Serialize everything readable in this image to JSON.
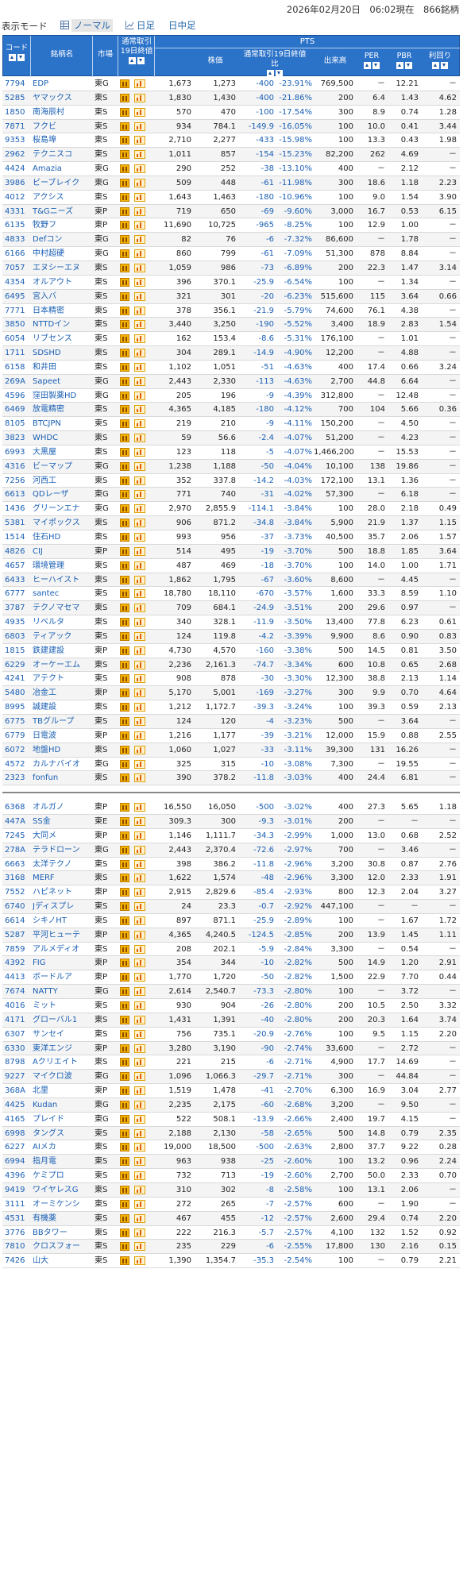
{
  "header": {
    "timestamp": "2026年02月20日　06:02現在　866銘柄"
  },
  "modes": {
    "label": "表示モード",
    "items": [
      {
        "label": "ノーマル",
        "icon": "grid-icon",
        "active": true
      },
      {
        "label": "日足",
        "icon": "line-chart-icon",
        "active": false
      },
      {
        "label": "日中足",
        "icon": "none",
        "active": false
      }
    ]
  },
  "columns": {
    "code": "コード",
    "name": "銘柄名",
    "market": "市場",
    "close": "通常取引19日終値",
    "pts": "PTS",
    "price": "株価",
    "chg": "通常取引19日終値比",
    "vol": "出来高",
    "per": "PER",
    "pbr": "PBR",
    "yield": "利回り"
  },
  "colors": {
    "header_bg": "#2b72c9",
    "link": "#1a5fb4",
    "negative": "#1a5fb4"
  },
  "rows": [
    [
      "7794",
      "EDP",
      "東G",
      "1,673",
      "1,273",
      "-400",
      "-23.91%",
      "769,500",
      "－",
      "12.21",
      "－"
    ],
    [
      "5285",
      "ヤマックス",
      "東S",
      "1,830",
      "1,430",
      "-400",
      "-21.86%",
      "200",
      "6.4",
      "1.43",
      "4.62"
    ],
    [
      "1850",
      "南海辰村",
      "東S",
      "570",
      "470",
      "-100",
      "-17.54%",
      "300",
      "8.9",
      "0.74",
      "1.28"
    ],
    [
      "7871",
      "フクビ",
      "東S",
      "934",
      "784.1",
      "-149.9",
      "-16.05%",
      "100",
      "10.0",
      "0.41",
      "3.44"
    ],
    [
      "9353",
      "桜島埠",
      "東S",
      "2,710",
      "2,277",
      "-433",
      "-15.98%",
      "100",
      "13.3",
      "0.43",
      "1.98"
    ],
    [
      "2962",
      "テクニスコ",
      "東S",
      "1,011",
      "857",
      "-154",
      "-15.23%",
      "82,200",
      "262",
      "4.69",
      "－"
    ],
    [
      "4424",
      "Amazia",
      "東G",
      "290",
      "252",
      "-38",
      "-13.10%",
      "400",
      "－",
      "2.12",
      "－"
    ],
    [
      "3986",
      "ビーブレイク",
      "東G",
      "509",
      "448",
      "-61",
      "-11.98%",
      "300",
      "18.6",
      "1.18",
      "2.23"
    ],
    [
      "4012",
      "アクシス",
      "東S",
      "1,643",
      "1,463",
      "-180",
      "-10.96%",
      "100",
      "9.0",
      "1.54",
      "3.90"
    ],
    [
      "4331",
      "T&Gニーズ",
      "東P",
      "719",
      "650",
      "-69",
      "-9.60%",
      "3,000",
      "16.7",
      "0.53",
      "6.15"
    ],
    [
      "6135",
      "牧野フ",
      "東P",
      "11,690",
      "10,725",
      "-965",
      "-8.25%",
      "100",
      "12.9",
      "1.00",
      "－"
    ],
    [
      "4833",
      "Defコン",
      "東G",
      "82",
      "76",
      "-6",
      "-7.32%",
      "86,600",
      "－",
      "1.78",
      "－"
    ],
    [
      "6166",
      "中村超硬",
      "東G",
      "860",
      "799",
      "-61",
      "-7.09%",
      "51,300",
      "878",
      "8.84",
      "－"
    ],
    [
      "7057",
      "エヌシーエヌ",
      "東S",
      "1,059",
      "986",
      "-73",
      "-6.89%",
      "200",
      "22.3",
      "1.47",
      "3.14"
    ],
    [
      "4354",
      "オルアウト",
      "東S",
      "396",
      "370.1",
      "-25.9",
      "-6.54%",
      "100",
      "－",
      "1.34",
      "－"
    ],
    [
      "6495",
      "宮入バ",
      "東S",
      "321",
      "301",
      "-20",
      "-6.23%",
      "515,600",
      "115",
      "3.64",
      "0.66"
    ],
    [
      "7771",
      "日本精密",
      "東S",
      "378",
      "356.1",
      "-21.9",
      "-5.79%",
      "74,600",
      "76.1",
      "4.38",
      "－"
    ],
    [
      "3850",
      "NTTDイン",
      "東S",
      "3,440",
      "3,250",
      "-190",
      "-5.52%",
      "3,400",
      "18.9",
      "2.83",
      "1.54"
    ],
    [
      "6054",
      "リブセンス",
      "東S",
      "162",
      "153.4",
      "-8.6",
      "-5.31%",
      "176,100",
      "－",
      "1.01",
      "－"
    ],
    [
      "1711",
      "SDSHD",
      "東S",
      "304",
      "289.1",
      "-14.9",
      "-4.90%",
      "12,200",
      "－",
      "4.88",
      "－"
    ],
    [
      "6158",
      "和井田",
      "東S",
      "1,102",
      "1,051",
      "-51",
      "-4.63%",
      "400",
      "17.4",
      "0.66",
      "3.24"
    ],
    [
      "269A",
      "Sapeet",
      "東G",
      "2,443",
      "2,330",
      "-113",
      "-4.63%",
      "2,700",
      "44.8",
      "6.64",
      "－"
    ],
    [
      "4596",
      "窪田製薬HD",
      "東G",
      "205",
      "196",
      "-9",
      "-4.39%",
      "312,800",
      "－",
      "12.48",
      "－"
    ],
    [
      "6469",
      "放電精密",
      "東S",
      "4,365",
      "4,185",
      "-180",
      "-4.12%",
      "700",
      "104",
      "5.66",
      "0.36"
    ],
    [
      "8105",
      "BTCJPN",
      "東S",
      "219",
      "210",
      "-9",
      "-4.11%",
      "150,200",
      "－",
      "4.50",
      "－"
    ],
    [
      "3823",
      "WHDC",
      "東S",
      "59",
      "56.6",
      "-2.4",
      "-4.07%",
      "51,200",
      "－",
      "4.23",
      "－"
    ],
    [
      "6993",
      "大黒屋",
      "東S",
      "123",
      "118",
      "-5",
      "-4.07%",
      "1,466,200",
      "－",
      "15.53",
      "－"
    ],
    [
      "4316",
      "ビーマップ",
      "東G",
      "1,238",
      "1,188",
      "-50",
      "-4.04%",
      "10,100",
      "138",
      "19.86",
      "－"
    ],
    [
      "7256",
      "河西工",
      "東S",
      "352",
      "337.8",
      "-14.2",
      "-4.03%",
      "172,100",
      "13.1",
      "1.36",
      "－"
    ],
    [
      "6613",
      "QDレーザ",
      "東G",
      "771",
      "740",
      "-31",
      "-4.02%",
      "57,300",
      "－",
      "6.18",
      "－"
    ],
    [
      "1436",
      "グリーンエナ",
      "東G",
      "2,970",
      "2,855.9",
      "-114.1",
      "-3.84%",
      "100",
      "28.0",
      "2.18",
      "0.49"
    ],
    [
      "5381",
      "マイポックス",
      "東S",
      "906",
      "871.2",
      "-34.8",
      "-3.84%",
      "5,900",
      "21.9",
      "1.37",
      "1.15"
    ],
    [
      "1514",
      "住石HD",
      "東S",
      "993",
      "956",
      "-37",
      "-3.73%",
      "40,500",
      "35.7",
      "2.06",
      "1.57"
    ],
    [
      "4826",
      "CIJ",
      "東P",
      "514",
      "495",
      "-19",
      "-3.70%",
      "500",
      "18.8",
      "1.85",
      "3.64"
    ],
    [
      "4657",
      "環境管理",
      "東S",
      "487",
      "469",
      "-18",
      "-3.70%",
      "100",
      "14.0",
      "1.00",
      "1.71"
    ],
    [
      "6433",
      "ヒーハイスト",
      "東S",
      "1,862",
      "1,795",
      "-67",
      "-3.60%",
      "8,600",
      "－",
      "4.45",
      "－"
    ],
    [
      "6777",
      "santec",
      "東S",
      "18,780",
      "18,110",
      "-670",
      "-3.57%",
      "1,600",
      "33.3",
      "8.59",
      "1.10"
    ],
    [
      "3787",
      "テクノマセマ",
      "東S",
      "709",
      "684.1",
      "-24.9",
      "-3.51%",
      "200",
      "29.6",
      "0.97",
      "－"
    ],
    [
      "4935",
      "リベルタ",
      "東S",
      "340",
      "328.1",
      "-11.9",
      "-3.50%",
      "13,400",
      "77.8",
      "6.23",
      "0.61"
    ],
    [
      "6803",
      "ティアック",
      "東S",
      "124",
      "119.8",
      "-4.2",
      "-3.39%",
      "9,900",
      "8.6",
      "0.90",
      "0.83"
    ],
    [
      "1815",
      "鉄建建設",
      "東P",
      "4,730",
      "4,570",
      "-160",
      "-3.38%",
      "500",
      "14.5",
      "0.81",
      "3.50"
    ],
    [
      "6229",
      "オーケーエム",
      "東S",
      "2,236",
      "2,161.3",
      "-74.7",
      "-3.34%",
      "600",
      "10.8",
      "0.65",
      "2.68"
    ],
    [
      "4241",
      "アテクト",
      "東S",
      "908",
      "878",
      "-30",
      "-3.30%",
      "12,300",
      "38.8",
      "2.13",
      "1.14"
    ],
    [
      "5480",
      "冶金工",
      "東P",
      "5,170",
      "5,001",
      "-169",
      "-3.27%",
      "300",
      "9.9",
      "0.70",
      "4.64"
    ],
    [
      "8995",
      "誠建設",
      "東S",
      "1,212",
      "1,172.7",
      "-39.3",
      "-3.24%",
      "100",
      "39.3",
      "0.59",
      "2.13"
    ],
    [
      "6775",
      "TBグループ",
      "東S",
      "124",
      "120",
      "-4",
      "-3.23%",
      "500",
      "－",
      "3.64",
      "－"
    ],
    [
      "6779",
      "日電波",
      "東P",
      "1,216",
      "1,177",
      "-39",
      "-3.21%",
      "12,000",
      "15.9",
      "0.88",
      "2.55"
    ],
    [
      "6072",
      "地盤HD",
      "東S",
      "1,060",
      "1,027",
      "-33",
      "-3.11%",
      "39,300",
      "131",
      "16.26",
      "－"
    ],
    [
      "4572",
      "カルナバイオ",
      "東G",
      "325",
      "315",
      "-10",
      "-3.08%",
      "7,300",
      "－",
      "19.55",
      "－"
    ],
    [
      "2323",
      "fonfun",
      "東S",
      "390",
      "378.2",
      "-11.8",
      "-3.03%",
      "400",
      "24.4",
      "6.81",
      "－"
    ],
    [
      "6368",
      "オルガノ",
      "東P",
      "16,550",
      "16,050",
      "-500",
      "-3.02%",
      "400",
      "27.3",
      "5.65",
      "1.18"
    ],
    [
      "447A",
      "SS金",
      "東E",
      "309.3",
      "300",
      "-9.3",
      "-3.01%",
      "200",
      "－",
      "－",
      "－"
    ],
    [
      "7245",
      "大同メ",
      "東P",
      "1,146",
      "1,111.7",
      "-34.3",
      "-2.99%",
      "1,000",
      "13.0",
      "0.68",
      "2.52"
    ],
    [
      "278A",
      "テラドローン",
      "東G",
      "2,443",
      "2,370.4",
      "-72.6",
      "-2.97%",
      "700",
      "－",
      "3.46",
      "－"
    ],
    [
      "6663",
      "太洋テクノ",
      "東S",
      "398",
      "386.2",
      "-11.8",
      "-2.96%",
      "3,200",
      "30.8",
      "0.87",
      "2.76"
    ],
    [
      "3168",
      "MERF",
      "東S",
      "1,622",
      "1,574",
      "-48",
      "-2.96%",
      "3,300",
      "12.0",
      "2.33",
      "1.91"
    ],
    [
      "7552",
      "ハピネット",
      "東P",
      "2,915",
      "2,829.6",
      "-85.4",
      "-2.93%",
      "800",
      "12.3",
      "2.04",
      "3.27"
    ],
    [
      "6740",
      "Jディスプレ",
      "東S",
      "24",
      "23.3",
      "-0.7",
      "-2.92%",
      "447,100",
      "－",
      "－",
      "－"
    ],
    [
      "6614",
      "シキノHT",
      "東S",
      "897",
      "871.1",
      "-25.9",
      "-2.89%",
      "100",
      "－",
      "1.67",
      "1.72"
    ],
    [
      "5287",
      "平河ヒューテ",
      "東P",
      "4,365",
      "4,240.5",
      "-124.5",
      "-2.85%",
      "200",
      "13.9",
      "1.45",
      "1.11"
    ],
    [
      "7859",
      "アルメディオ",
      "東S",
      "208",
      "202.1",
      "-5.9",
      "-2.84%",
      "3,300",
      "－",
      "0.54",
      "－"
    ],
    [
      "4392",
      "FIG",
      "東P",
      "354",
      "344",
      "-10",
      "-2.82%",
      "500",
      "14.9",
      "1.20",
      "2.91"
    ],
    [
      "4413",
      "ボードルア",
      "東P",
      "1,770",
      "1,720",
      "-50",
      "-2.82%",
      "1,500",
      "22.9",
      "7.70",
      "0.44"
    ],
    [
      "7674",
      "NATTY",
      "東G",
      "2,614",
      "2,540.7",
      "-73.3",
      "-2.80%",
      "100",
      "－",
      "3.72",
      "－"
    ],
    [
      "4016",
      "ミット",
      "東S",
      "930",
      "904",
      "-26",
      "-2.80%",
      "200",
      "10.5",
      "2.50",
      "3.32"
    ],
    [
      "4171",
      "グローバル1",
      "東S",
      "1,431",
      "1,391",
      "-40",
      "-2.80%",
      "200",
      "20.3",
      "1.64",
      "3.74"
    ],
    [
      "6307",
      "サンセイ",
      "東S",
      "756",
      "735.1",
      "-20.9",
      "-2.76%",
      "100",
      "9.5",
      "1.15",
      "2.20"
    ],
    [
      "6330",
      "東洋エンジ",
      "東P",
      "3,280",
      "3,190",
      "-90",
      "-2.74%",
      "33,600",
      "－",
      "2.72",
      "－"
    ],
    [
      "8798",
      "Aクリエイト",
      "東S",
      "221",
      "215",
      "-6",
      "-2.71%",
      "4,900",
      "17.7",
      "14.69",
      "－"
    ],
    [
      "9227",
      "マイクロ波",
      "東G",
      "1,096",
      "1,066.3",
      "-29.7",
      "-2.71%",
      "300",
      "－",
      "44.84",
      "－"
    ],
    [
      "368A",
      "北里",
      "東P",
      "1,519",
      "1,478",
      "-41",
      "-2.70%",
      "6,300",
      "16.9",
      "3.04",
      "2.77"
    ],
    [
      "4425",
      "Kudan",
      "東G",
      "2,235",
      "2,175",
      "-60",
      "-2.68%",
      "3,200",
      "－",
      "9.50",
      "－"
    ],
    [
      "4165",
      "プレイド",
      "東G",
      "522",
      "508.1",
      "-13.9",
      "-2.66%",
      "2,400",
      "19.7",
      "4.15",
      "－"
    ],
    [
      "6998",
      "タングス",
      "東S",
      "2,188",
      "2,130",
      "-58",
      "-2.65%",
      "500",
      "14.8",
      "0.79",
      "2.35"
    ],
    [
      "6227",
      "AIメカ",
      "東S",
      "19,000",
      "18,500",
      "-500",
      "-2.63%",
      "2,800",
      "37.7",
      "9.22",
      "0.28"
    ],
    [
      "6994",
      "指月電",
      "東S",
      "963",
      "938",
      "-25",
      "-2.60%",
      "100",
      "13.2",
      "0.96",
      "2.24"
    ],
    [
      "4396",
      "ケミプロ",
      "東S",
      "732",
      "713",
      "-19",
      "-2.60%",
      "2,700",
      "50.0",
      "2.33",
      "0.70"
    ],
    [
      "9419",
      "ワイヤレスG",
      "東S",
      "310",
      "302",
      "-8",
      "-2.58%",
      "100",
      "13.1",
      "2.06",
      "－"
    ],
    [
      "3111",
      "オーミケンシ",
      "東S",
      "272",
      "265",
      "-7",
      "-2.57%",
      "600",
      "－",
      "1.90",
      "－"
    ],
    [
      "4531",
      "有機薬",
      "東S",
      "467",
      "455",
      "-12",
      "-2.57%",
      "2,600",
      "29.4",
      "0.74",
      "2.20"
    ],
    [
      "3776",
      "BBタワー",
      "東S",
      "222",
      "216.3",
      "-5.7",
      "-2.57%",
      "4,100",
      "132",
      "1.52",
      "0.92"
    ],
    [
      "7810",
      "クロスフォー",
      "東S",
      "235",
      "229",
      "-6",
      "-2.55%",
      "17,800",
      "130",
      "2.16",
      "0.15"
    ],
    [
      "7426",
      "山大",
      "東S",
      "1,390",
      "1,354.7",
      "-35.3",
      "-2.54%",
      "100",
      "－",
      "0.79",
      "2.21"
    ]
  ]
}
